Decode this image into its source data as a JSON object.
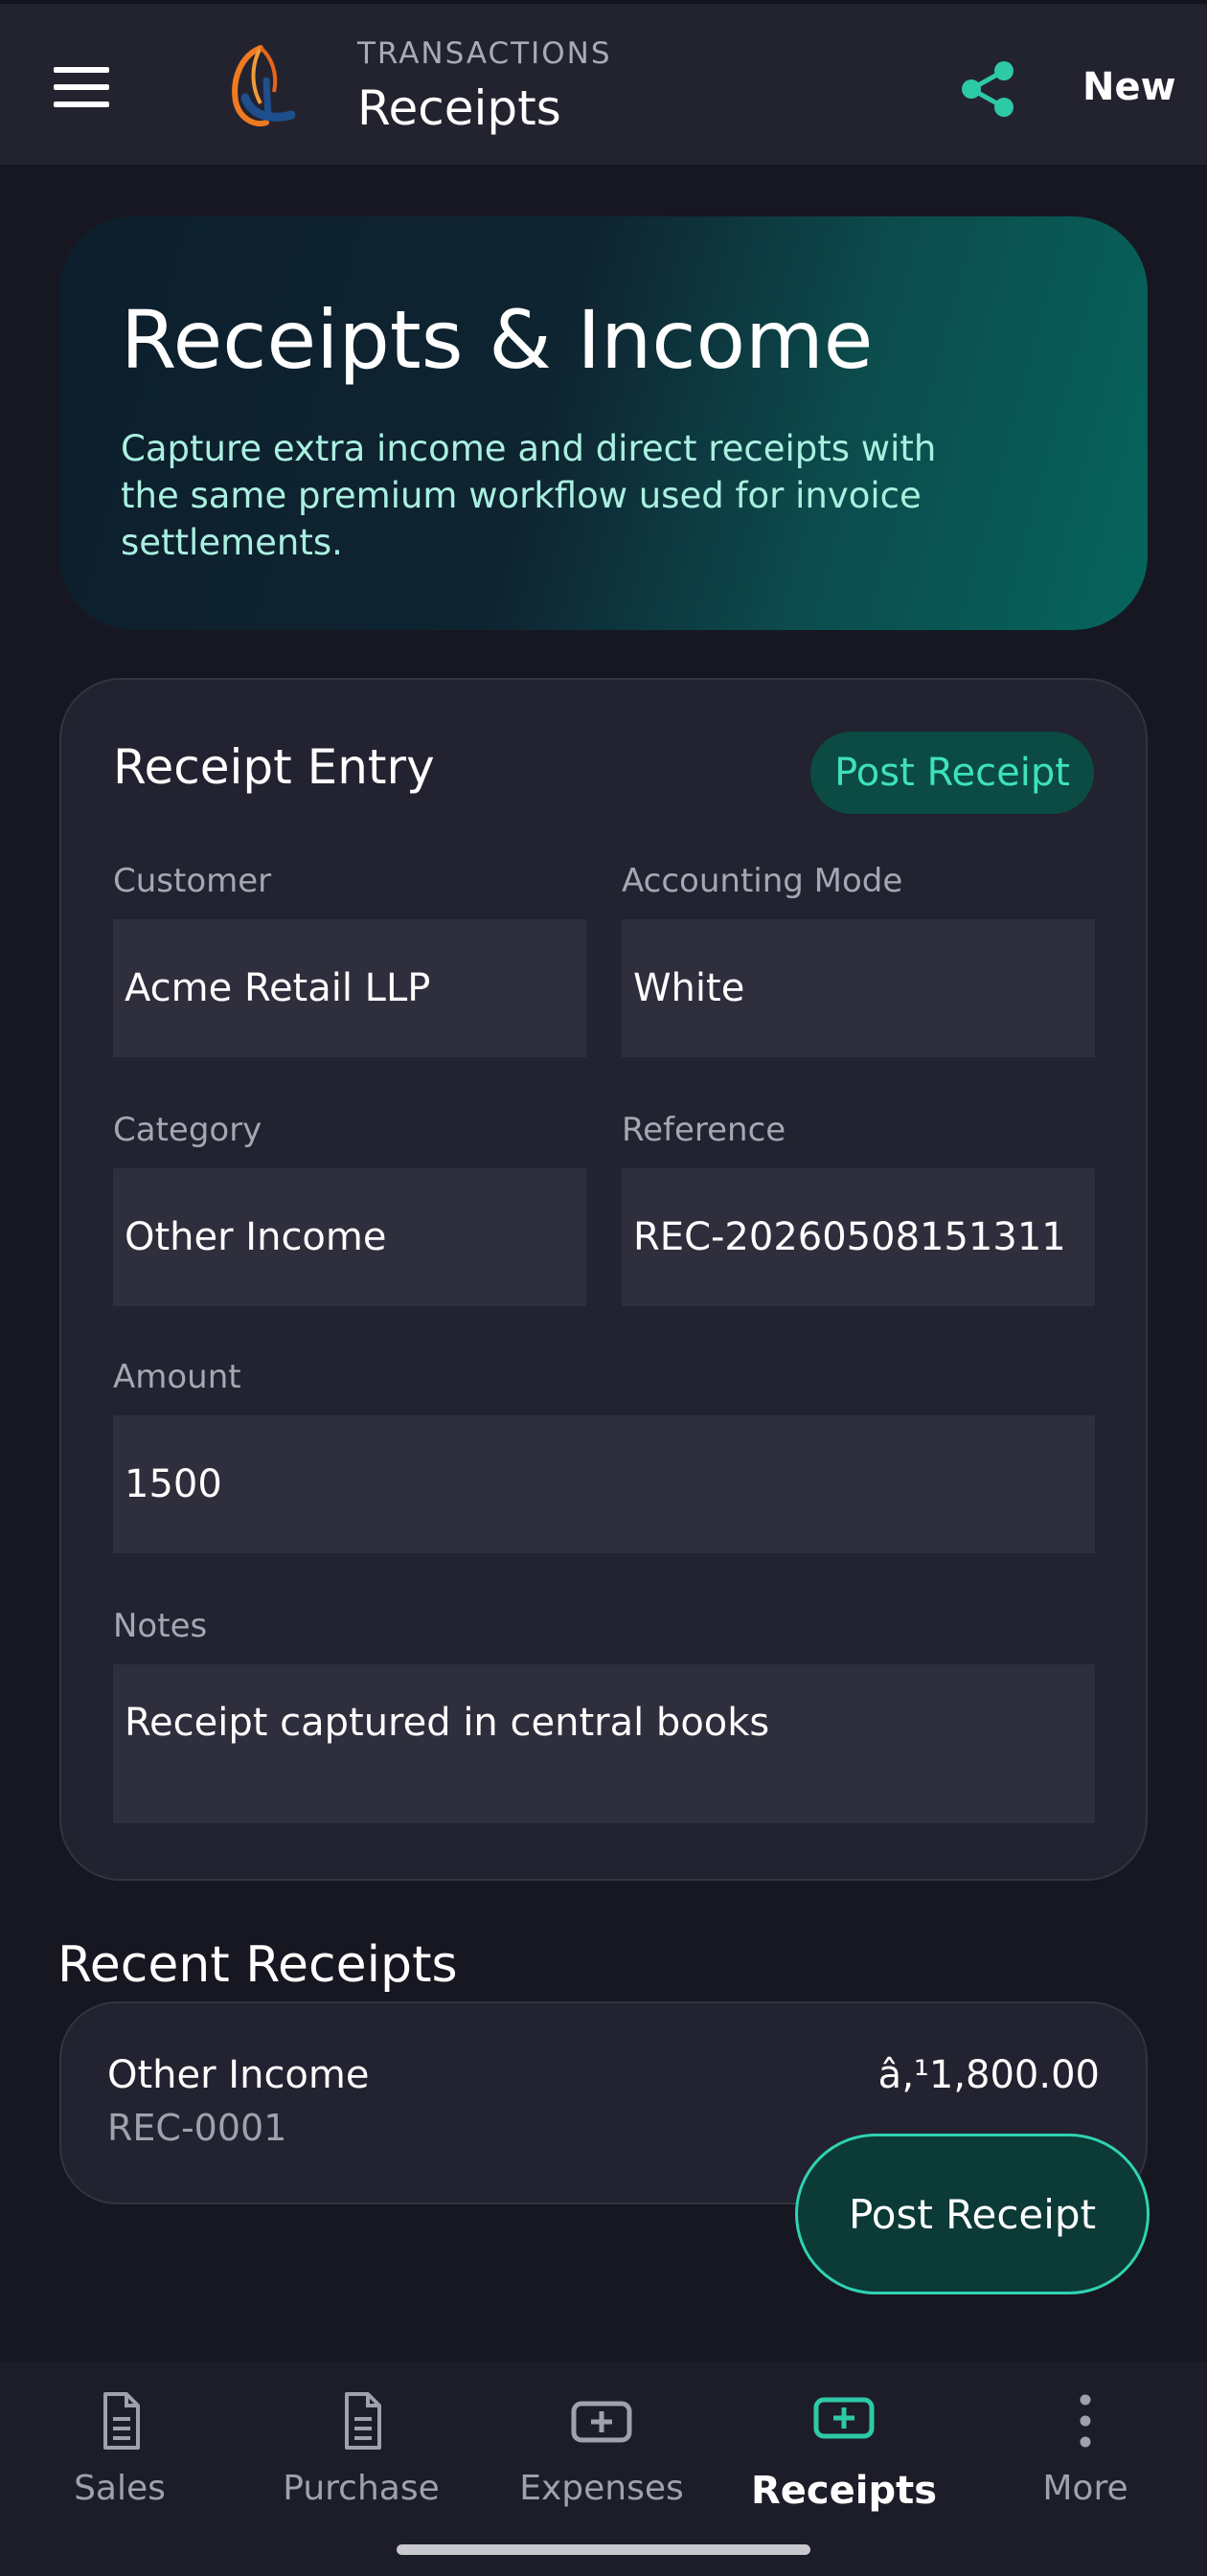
{
  "header": {
    "overline": "TRANSACTIONS",
    "title": "Receipts",
    "new_label": "New",
    "accent_color": "#2ec9a7"
  },
  "hero": {
    "title": "Receipts & Income",
    "description": "Capture extra income and direct receipts with the same premium workflow used for invoice settlements."
  },
  "form": {
    "title": "Receipt Entry",
    "post_label": "Post Receipt",
    "fields": {
      "customer": {
        "label": "Customer",
        "value": "Acme Retail LLP"
      },
      "accounting_mode": {
        "label": "Accounting Mode",
        "value": "White"
      },
      "category": {
        "label": "Category",
        "value": "Other Income"
      },
      "reference": {
        "label": "Reference",
        "value": "REC-20260508151311"
      },
      "amount": {
        "label": "Amount",
        "value": "1500"
      },
      "notes": {
        "label": "Notes",
        "value": "Receipt captured in central books"
      }
    }
  },
  "recent": {
    "title": "Recent Receipts",
    "items": [
      {
        "name": "Other Income",
        "ref": "REC-0001",
        "amount": "â‚¹1,800.00"
      }
    ]
  },
  "fab": {
    "label": "Post Receipt"
  },
  "nav": {
    "items": [
      {
        "label": "Sales",
        "icon": "document-icon"
      },
      {
        "label": "Purchase",
        "icon": "document-icon"
      },
      {
        "label": "Expenses",
        "icon": "plus-box-icon"
      },
      {
        "label": "Receipts",
        "icon": "plus-box-icon",
        "active": true
      },
      {
        "label": "More",
        "icon": "more-vertical-icon"
      }
    ]
  }
}
